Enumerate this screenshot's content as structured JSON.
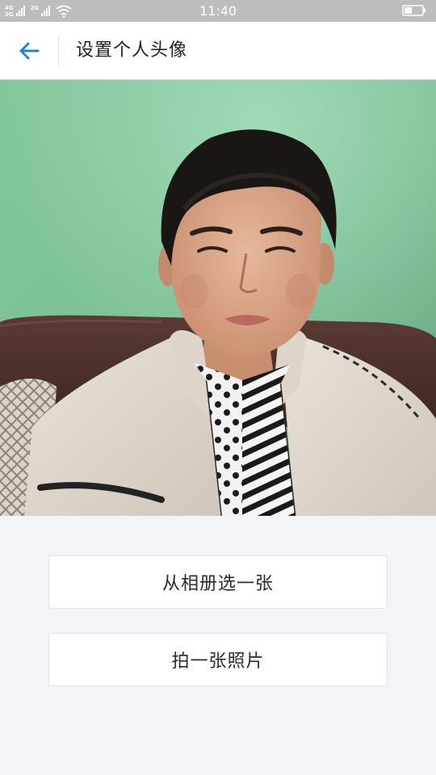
{
  "status_bar": {
    "time": "11:40",
    "network_top": "4G",
    "network_bottom": "2G",
    "network2": "2G",
    "icons": [
      "signal-4g-icon",
      "signal-2g-icon",
      "wifi-icon",
      "battery-icon"
    ]
  },
  "header": {
    "back_icon": "arrow-left-icon",
    "title": "设置个人头像",
    "accent_color": "#1e88d8"
  },
  "photo": {
    "description_icon": "avatar-preview-photo"
  },
  "actions": {
    "choose_from_album": "从相册选一张",
    "take_photo": "拍一张照片"
  }
}
